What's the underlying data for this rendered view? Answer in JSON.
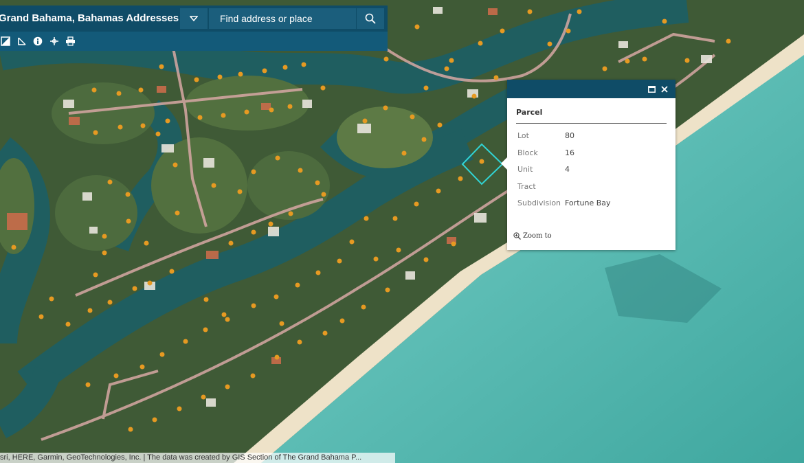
{
  "header": {
    "title": "Grand Bahama, Bahamas Addresses",
    "search_placeholder": "Find address or place"
  },
  "toolbar": {
    "tools": [
      "basemap-icon",
      "measure-icon",
      "info-icon",
      "move-icon",
      "print-icon"
    ]
  },
  "popup": {
    "title": "Parcel",
    "fields": [
      {
        "label": "Lot",
        "value": "80"
      },
      {
        "label": "Block",
        "value": "16"
      },
      {
        "label": "Unit",
        "value": "4"
      },
      {
        "label": "Tract",
        "value": ""
      },
      {
        "label": "Subdivision",
        "value": "Fortune Bay"
      }
    ],
    "zoom_label": "Zoom to"
  },
  "attribution": "sri, HERE, Garmin, GeoTechnologies, Inc. | The data was created by GIS Section of The Grand Bahama P...",
  "colors": {
    "header_bg": "#0f4c67",
    "selection": "#31d4d4",
    "parcel_marker": "#e69a22"
  }
}
